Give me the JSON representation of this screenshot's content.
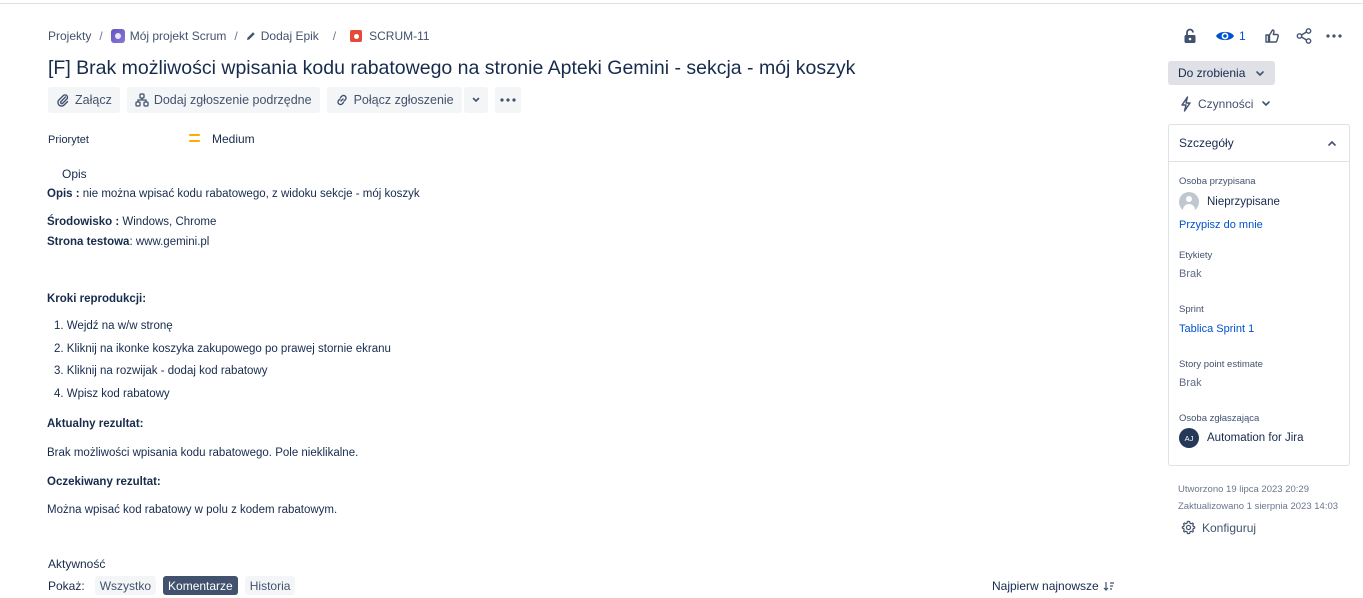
{
  "breadcrumb": {
    "projects": "Projekty",
    "project": "Mój projekt Scrum",
    "epic": "Dodaj Epik",
    "issue_key": "SCRUM-11",
    "separator": "/"
  },
  "issue": {
    "title": "[F] Brak możliwości wpisania kodu rabatowego na stronie Apteki Gemini - sekcja - mój koszyk"
  },
  "toolbar": {
    "attach": "Załącz",
    "add_child": "Dodaj zgłoszenie podrzędne",
    "link_issue": "Połącz zgłoszenie"
  },
  "priority": {
    "label": "Priorytet",
    "value": "Medium",
    "color": "#ffab00"
  },
  "description": {
    "heading": "Opis",
    "opis_label": "Opis :",
    "opis_text": " nie można wpisać kodu rabatowego, z widoku sekcje - mój koszyk",
    "env_label": "Środowisko :",
    "env_text": " Windows, Chrome",
    "site_label": "Strona testowa",
    "site_sep": ":",
    "site_text": " www.gemini.pl",
    "steps_label": "Kroki reprodukcji:",
    "steps": [
      "1. Wejdź na w/w stronę",
      "2. Kliknij na ikonke koszyka zakupowego po prawej stornie ekranu",
      "3. Kliknij na rozwijak - dodaj kod rabatowy",
      "4. Wpisz kod rabatowy"
    ],
    "actual_label": "Aktualny rezultat:",
    "actual_text": "Brak możliwości wpisania kodu rabatowego. Pole nieklikalne.",
    "expected_label": "Oczekiwany rezultat:",
    "expected_text": "Można wpisać kod rabatowy w polu z kodem rabatowym."
  },
  "activity": {
    "heading": "Aktywność",
    "show_label": "Pokaż:",
    "filters": [
      "Wszystko",
      "Komentarze",
      "Historia"
    ],
    "active_filter": "Komentarze",
    "sort_label": "Najpierw najnowsze"
  },
  "header_actions": {
    "watchers_count": "1",
    "accent": "#0052cc"
  },
  "status": {
    "label": "Do zrobienia"
  },
  "actions": {
    "label": "Czynności"
  },
  "details": {
    "heading": "Szczegóły",
    "assignee_label": "Osoba przypisana",
    "assignee_value": "Nieprzypisane",
    "assign_to_me": "Przypisz do mnie",
    "labels_label": "Etykiety",
    "labels_value": "Brak",
    "sprint_label": "Sprint",
    "sprint_value": "Tablica Sprint 1",
    "story_points_label": "Story point estimate",
    "story_points_value": "Brak",
    "reporter_label": "Osoba zgłaszająca",
    "reporter_initials": "AJ",
    "reporter_value": "Automation for Jira"
  },
  "meta": {
    "created": "Utworzono 19 lipca 2023 20:29",
    "updated": "Zaktualizowano 1 sierpnia 2023 14:03",
    "configure": "Konfiguruj"
  }
}
